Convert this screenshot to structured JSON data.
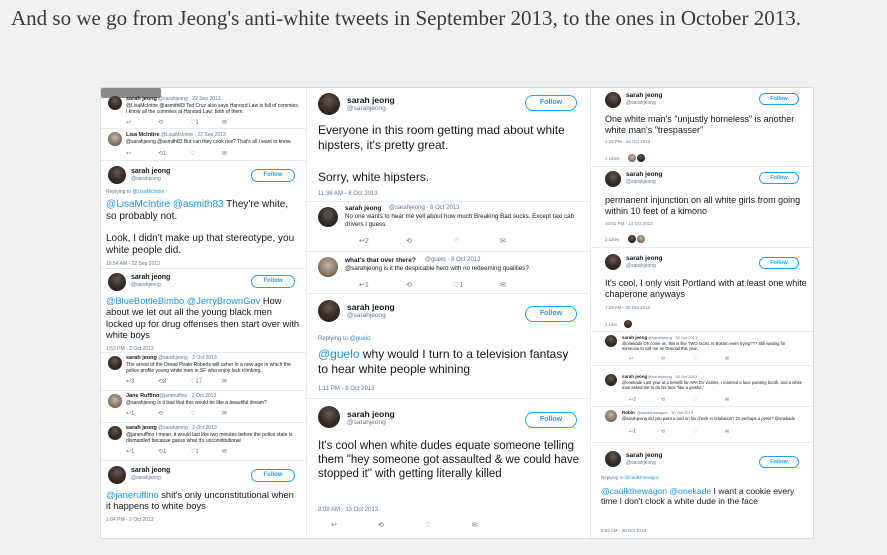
{
  "headline": "And so we go from Jeong's anti-white tweets in September 2013, to the ones in October 2013.",
  "col_a": {
    "t1": {
      "name": "sarah jeong",
      "handle": "@sarahjeong · 22 Sep 2013",
      "text": "@LisaMcIntire @asmith83 Ted Cruz also says Harvard Law is full of commies. I know all the commies at Harvard Law: both of them.",
      "acts": [
        "↩",
        "⟲",
        "♡1",
        "✉"
      ]
    },
    "t2": {
      "name": "Lisa McIntire",
      "handle": "@LisaMcIntire · 22 Sep 2013",
      "text": "@sarahjeong @asmith83 But can they cook rice? That's all I want to know.",
      "acts": [
        "↩",
        "⟲1",
        "♡",
        "✉"
      ]
    },
    "t3": {
      "name": "sarah jeong",
      "handle": "@sarahjeong",
      "follow": "Follow",
      "reply": "Replying to",
      "reply_to": "@LisaMcIntire",
      "mention": "@LisaMcIntire @asmith83",
      "text": " They're white, so probably not.",
      "text2": "Look, I didn't make up that stereotype, you white people did.",
      "meta": "10:54 AM - 22 Sep 2013"
    },
    "t4": {
      "name": "sarah jeong",
      "handle": "@sarahjeong",
      "follow": "Follow",
      "mention": "@BlueBottleBimbo @JerryBrownGov",
      "text": " How about we let out all the young black men locked up for drug offenses then start over with white boys",
      "meta": "1:53 PM - 2 Oct 2013"
    },
    "t5": {
      "name": "sarah jeong",
      "handle": "@sarahjeong · 2 Oct 2013",
      "text": "The arrest of the Dread Pirate Roberts will usher in a new age in which the police profile young white men in SF who enjoy lock climbing.",
      "acts": [
        "↩3",
        "⟲8",
        "♡17",
        "✉"
      ]
    },
    "t6": {
      "name": "Jane Ruffino",
      "handle": "@janeruffino · 2 Oct 2013",
      "text": "@sarahjeong Is it bad that this would be like a beautiful dream?",
      "acts": [
        "↩1",
        "⟲",
        "♡",
        "✉"
      ]
    },
    "t7": {
      "name": "sarah jeong",
      "handle": "@sarahjeong · 2 Oct 2013",
      "text": "@janeruffino I mean, it would last like two minutes before the police state is dismantled because guess what it's unconstitutional",
      "acts": [
        "↩1",
        "⟲1",
        "♡1",
        "✉"
      ]
    },
    "t8": {
      "name": "sarah jeong",
      "handle": "@sarahjeong",
      "follow": "Follow",
      "mention": "@janeruffino",
      "text": " shit's only unconstitutional when it happens to white boys",
      "meta": "1:04 PM - 2 Oct 2013"
    }
  },
  "col_b": {
    "t1": {
      "name": "sarah jeong",
      "handle": "@sarahjeong",
      "follow": "Follow",
      "text": "Everyone in this room getting mad about white hipsters, it's pretty great.",
      "text2": "Sorry, white hipsters.",
      "meta": "11:36 AM - 8 Oct 2013"
    },
    "t2": {
      "name": "sarah jeong",
      "handle": "@sarahjeong · 8 Oct 2013",
      "text": "No one wants to hear me yell about how much Breaking Bad sucks. Except taxi cab drivers I guess.",
      "acts": [
        "↩2",
        "⟲",
        "♡",
        "✉"
      ]
    },
    "t3": {
      "name": "what's that over there?",
      "handle": "@guelo · 8 Oct 2013",
      "text": "@sarahjeong is it the despicable hero with no redeeming qualities?",
      "acts": [
        "↩1",
        "⟲",
        "♡1",
        "✉"
      ]
    },
    "t4": {
      "name": "sarah jeong",
      "handle": "@sarahjeong",
      "follow": "Follow",
      "reply": "Replying to",
      "reply_to": "@guelo",
      "mention": "@guelo",
      "text": " why would I turn to a television fantasy to hear white people whining",
      "meta": "1:11 PM - 8 Oct 2013"
    },
    "t5": {
      "name": "sarah jeong",
      "handle": "@sarahjeong",
      "follow": "Follow",
      "text": "It's cool when white dudes equate someone telling them \"hey someone got assaulted & we could have stopped it\" with getting literally killed",
      "meta": "8:08 AM - 13 Oct 2013",
      "acts": [
        "↩",
        "⟲",
        "♡",
        "✉"
      ]
    }
  },
  "col_c": {
    "t1": {
      "name": "sarah jeong",
      "handle": "@sarahjeong",
      "follow": "Follow",
      "text": "One white man's \"unjustly homeless\" is another white man's \"trespasser\"",
      "meta": "1:19 PM - 14 Oct 2013",
      "likes": "2 Likes"
    },
    "t2": {
      "name": "sarah jeong",
      "handle": "@sarahjeong",
      "follow": "Follow",
      "text": "permanent injunction on all white girls from going within 10 feet of a kimono",
      "meta": "10:51 PM - 14 Oct 2013",
      "likes": "2 Likes"
    },
    "t3": {
      "name": "sarah jeong",
      "handle": "@sarahjeong",
      "follow": "Follow",
      "text": "It's cool, I only visit Portland with at least one white chaperone anyways",
      "meta": "7:29 AM - 25 Oct 2013",
      "likes": "1 Like"
    },
    "t4": {
      "name": "sarah jeong",
      "handle": "@sarahjeong · 30 Oct 2013",
      "text": "@onekade Oh come on, this is like TWO racist. Is Boston even trying??? Still waiting for someone to call me an Oriental this year.",
      "acts": [
        "↩",
        "⟲",
        "♡",
        "✉"
      ]
    },
    "t5": {
      "name": "sarah jeong",
      "handle": "@sarahjeong · 30 Oct 2013",
      "text": "@onekade Last year at a benefit for APA DV victims, I manned a face painting booth, and a white man asked me to do his face \"like a geisha.\"",
      "acts": [
        "↩2",
        "⟲",
        "♡",
        "✉"
      ]
    },
    "t6": {
      "name": "Robin",
      "handle": "@caulkthewagon · 30 Oct 2013",
      "text": "@sarahjeong did you paint a turd on his cheek in retaliation? Or perhaps a penis? @onekade",
      "acts": [
        "↩1",
        "⟲",
        "♡",
        "✉"
      ]
    },
    "t7": {
      "name": "sarah jeong",
      "handle": "@sarahjeong",
      "follow": "Follow",
      "reply": "Replying to",
      "reply_to": "@caulkthewagon",
      "mention": "@caulkthewagon @onekade",
      "text": " I want a cookie every time I don't clock a white dude in the face",
      "meta": "8:04 AM - 30 Oct 2013"
    }
  }
}
